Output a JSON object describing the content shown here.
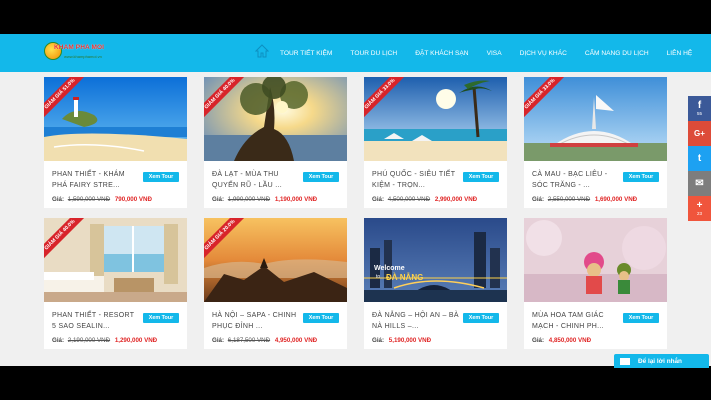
{
  "brand": {
    "logo_text": "KHAM PHA MOI",
    "logo_sub": "www.khamphamoi.vn"
  },
  "nav": {
    "items": [
      {
        "label": "TOUR TIẾT KIỆM"
      },
      {
        "label": "TOUR DU LỊCH"
      },
      {
        "label": "ĐẶT KHÁCH SẠN"
      },
      {
        "label": "VISA"
      },
      {
        "label": "DỊCH VỤ KHÁC"
      },
      {
        "label": "CẨM NANG DU LỊCH"
      },
      {
        "label": "LIÊN HỆ"
      }
    ]
  },
  "button_label": "Xem Tour",
  "price_label": "Giá:",
  "tours": [
    {
      "ribbon": "GIẢM GIÁ 51.0%",
      "title": "PHAN THIẾT - KHÁM PHÁ FAIRY STRE...",
      "old_price": "1,590,000 VNĐ",
      "new_price": "790,000 VNĐ"
    },
    {
      "ribbon": "GIẢM GIÁ 40.0%",
      "title": "ĐÀ LẠT - MÙA THU QUYẾN RŨ - LẦU ...",
      "old_price": "1,990,000 VNĐ",
      "new_price": "1,190,000 VNĐ"
    },
    {
      "ribbon": "GIẢM GIÁ 33.0%",
      "title": "PHÚ QUỐC - SIÊU TIẾT KIỆM - TRỌN...",
      "old_price": "4,500,000 VNĐ",
      "new_price": "2,990,000 VNĐ"
    },
    {
      "ribbon": "GIẢM GIÁ 33.0%",
      "title": "CÀ MAU - BẠC LIÊU - SÓC TRĂNG - ...",
      "old_price": "2,550,000 VNĐ",
      "new_price": "1,690,000 VNĐ"
    },
    {
      "ribbon": "GIẢM GIÁ 40.0%",
      "title": "PHAN THIẾT - RESORT 5 SAO SEALIN...",
      "old_price": "2,190,000 VNĐ",
      "new_price": "1,290,000 VNĐ"
    },
    {
      "ribbon": "GIẢM GIÁ 20.0%",
      "title": "HÀ NỘI – SAPA - CHINH PHỤC ĐỈNH ...",
      "old_price": "6,187,500 VNĐ",
      "new_price": "4,950,000 VNĐ"
    },
    {
      "ribbon": "",
      "title": "ĐÀ NẴNG – HỘI AN – BÀ NÀ HILLS –...",
      "old_price": "",
      "new_price": "5,190,000 VNĐ"
    },
    {
      "ribbon": "",
      "title": "MÙA HOA TAM GIÁC MẠCH - CHINH PH...",
      "old_price": "",
      "new_price": "4,850,000 VNĐ"
    }
  ],
  "share": [
    {
      "icon": "facebook-icon",
      "symbol": "f",
      "count": "55",
      "color": "#3b5998"
    },
    {
      "icon": "google-plus-icon",
      "symbol": "G+",
      "count": "",
      "color": "#dd4b39"
    },
    {
      "icon": "twitter-icon",
      "symbol": "t",
      "count": "",
      "color": "#1da1f2"
    },
    {
      "icon": "email-icon",
      "symbol": "✉",
      "count": "",
      "color": "#7d7d7d"
    },
    {
      "icon": "plus-icon",
      "symbol": "+",
      "count": "23",
      "color": "#f0553c"
    }
  ],
  "chat": {
    "label": "Để lại lời nhắn"
  },
  "colors": {
    "primary": "#13b8ea",
    "sale_red": "#e02525"
  }
}
